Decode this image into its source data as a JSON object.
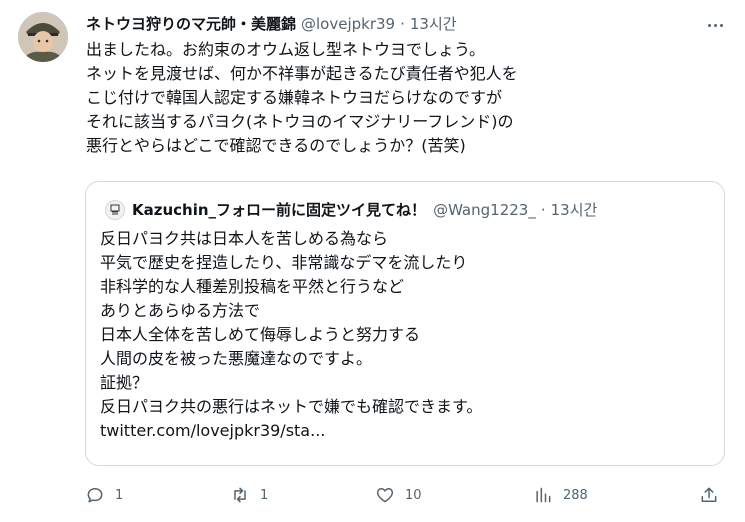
{
  "tweet": {
    "author_name": "ネトウヨ狩りのマ元帥・美麗錦",
    "author_handle": "@lovejpkr39",
    "time": "13시간",
    "separator": "·",
    "body_lines": [
      "出ましたね。お約束のオウム返し型ネトウヨでしょう。",
      "ネットを見渡せば、何か不祥事が起きるたび責任者や犯人を",
      "こじ付けで韓国人認定する嫌韓ネトウヨだらけなのですが",
      "それに該当するパヨク(ネトウヨのイマジナリーフレンド)の",
      "悪行とやらはどこで確認できるのでしょうか？(苦笑)"
    ]
  },
  "quote": {
    "author_name": "Kazuchin_フォロー前に固定ツイ見てね！",
    "author_handle": "@Wang1223_",
    "time": "13시간",
    "separator": "·",
    "body_lines": [
      "反日パヨク共は日本人を苦しめる為なら",
      "平気で歴史を捏造したり、非常識なデマを流したり",
      "非科学的な人種差別投稿を平然と行うなど",
      "ありとあらゆる方法で",
      "日本人全体を苦しめて侮辱しようと努力する",
      "人間の皮を被った悪魔達なのですよ。",
      "証拠？",
      "反日パヨク共の悪行はネットで嫌でも確認できます。",
      "twitter.com/lovejpkr39/sta..."
    ]
  },
  "actions": {
    "reply": {
      "icon": "reply-icon",
      "count": "1"
    },
    "retweet": {
      "icon": "retweet-icon",
      "count": "1"
    },
    "like": {
      "icon": "heart-icon",
      "count": "10"
    },
    "views": {
      "icon": "views-icon",
      "count": "288"
    },
    "share": {
      "icon": "share-icon"
    }
  },
  "colors": {
    "text": "#0f1419",
    "secondary": "#536471",
    "border": "#cfd9de"
  }
}
